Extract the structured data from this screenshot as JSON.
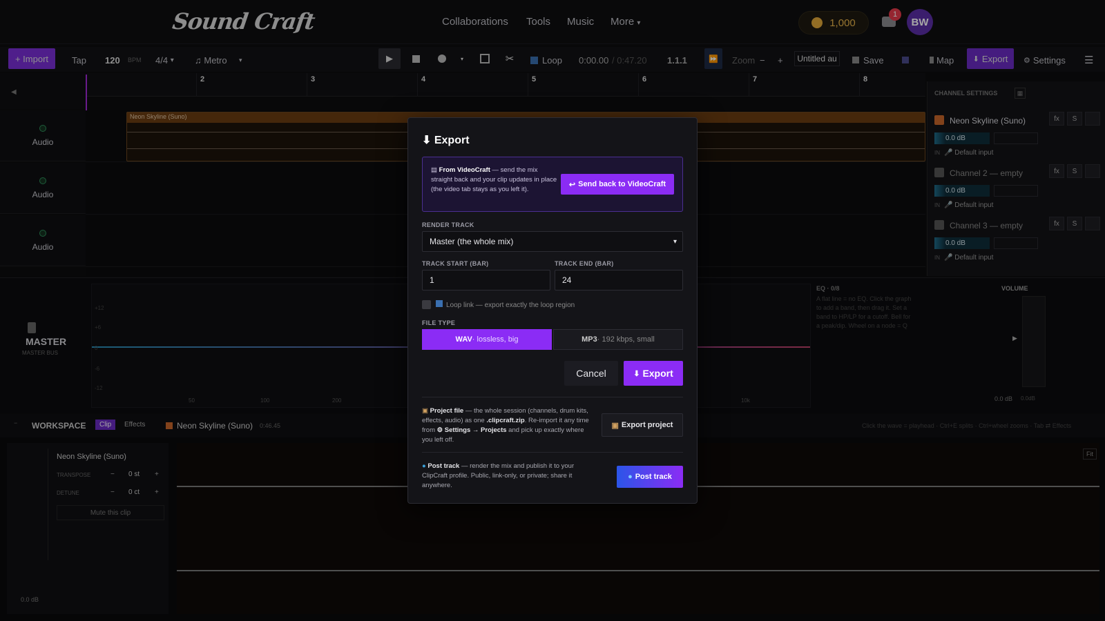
{
  "app": {
    "logo": "Sound Craft"
  },
  "nav": {
    "links": [
      "Collaborations",
      "Tools",
      "Music",
      "More"
    ],
    "coins": "1,000",
    "notifications": "1",
    "avatar": "BW"
  },
  "toolbar": {
    "import": "+ Import",
    "tap": "Tap",
    "bpm": "120",
    "bpm_unit": "BPM",
    "time_sig": "4/4",
    "metro": "Metro",
    "loop": "Loop",
    "time": "0:00.00",
    "total": "/ 0:47.20",
    "position": "1.1.1",
    "zoom": "Zoom",
    "zoom_minus": "−",
    "zoom_plus": "+",
    "project_name": "Untitled au",
    "save": "Save",
    "map": "Map",
    "export": "Export",
    "settings": "Settings"
  },
  "ruler": {
    "bars": [
      "2",
      "3",
      "4",
      "5",
      "6",
      "7",
      "8"
    ]
  },
  "tracks": [
    {
      "label": "Audio"
    },
    {
      "label": "Audio"
    },
    {
      "label": "Audio"
    }
  ],
  "clip": {
    "name": "Neon Skyline (Suno)"
  },
  "channel_settings": {
    "title": "CHANNEL SETTINGS",
    "channels": [
      {
        "name": "Neon Skyline (Suno)",
        "db": "0.0 dB",
        "input": "Default input",
        "color": "#c8662a"
      },
      {
        "name": "Channel 2 — empty",
        "db": "0.0 dB",
        "input": "Default input",
        "color": "#555"
      },
      {
        "name": "Channel 3 — empty",
        "db": "0.0 dB",
        "input": "Default input",
        "color": "#555"
      }
    ],
    "btn_fx": "fx",
    "btn_s": "S",
    "input_prefix": "IN"
  },
  "master": {
    "title": "MASTER",
    "subtitle": "MASTER BUS",
    "eq_title": "EQ · 0/8",
    "eq_help": "A flat line = no EQ. Click the graph to add a band, then drag it. Set a band to HP/LP for a cutoff. Bell for a peak/dip. Wheel on a node = Q",
    "eq_y": [
      "+12",
      "+6",
      "0",
      "-6",
      "-12"
    ],
    "eq_x": [
      "50",
      "100",
      "200",
      "10k"
    ],
    "volume": "VOLUME",
    "vol_db": "0.0 dB",
    "vol_db2": "0.0dB"
  },
  "workspace": {
    "title": "WORKSPACE",
    "tab_clip": "Clip",
    "tab_effects": "Effects",
    "clip_name": "Neon Skyline (Suno)",
    "clip_time": "0:46.45",
    "hint": "Click the wave = playhead · Ctrl+E splits · Ctrl+wheel zooms · Tab ⇄ Effects",
    "side_title": "Neon Skyline (Suno)",
    "transpose": "TRANSPOSE",
    "transpose_val": "0 st",
    "detune": "DETUNE",
    "detune_val": "0 ct",
    "mute": "Mute this clip",
    "db": "0.0 dB",
    "fit": "Fit"
  },
  "modal": {
    "title": "Export",
    "videocraft_title": "From VideoCraft",
    "videocraft_text": " — send the mix straight back and your clip updates in place (the video tab stays as you left it).",
    "videocraft_btn": "Send back to VideoCraft",
    "render_label": "RENDER TRACK",
    "render_value": "Master (the whole mix)",
    "start_label": "TRACK START (BAR)",
    "start_value": "1",
    "end_label": "TRACK END (BAR)",
    "end_value": "24",
    "loop_link": "Loop link — export exactly the loop region",
    "filetype_label": "FILE TYPE",
    "wav": "WAV",
    "wav_desc": " · lossless, big",
    "mp3": "MP3",
    "mp3_desc": " · 192 kbps, small",
    "cancel": "Cancel",
    "export": "Export",
    "project_title": "Project file",
    "project_text_1": " — the whole session (channels, drum kits, effects, audio) as one ",
    "project_ext": ".clipcraft.zip",
    "project_text_2": ". Re-import it any time from ",
    "project_path": "⚙ Settings → Projects",
    "project_text_3": " and pick up exactly where you left off.",
    "export_project": "Export project",
    "post_title": "Post track",
    "post_text": " — render the mix and publish it to your ClipCraft profile. Public, link-only, or private; share it anywhere.",
    "post_btn": "Post track"
  },
  "colors": {
    "accent": "#8b2cf5",
    "clip": "#6b3d12",
    "coin": "#e0a83a"
  }
}
